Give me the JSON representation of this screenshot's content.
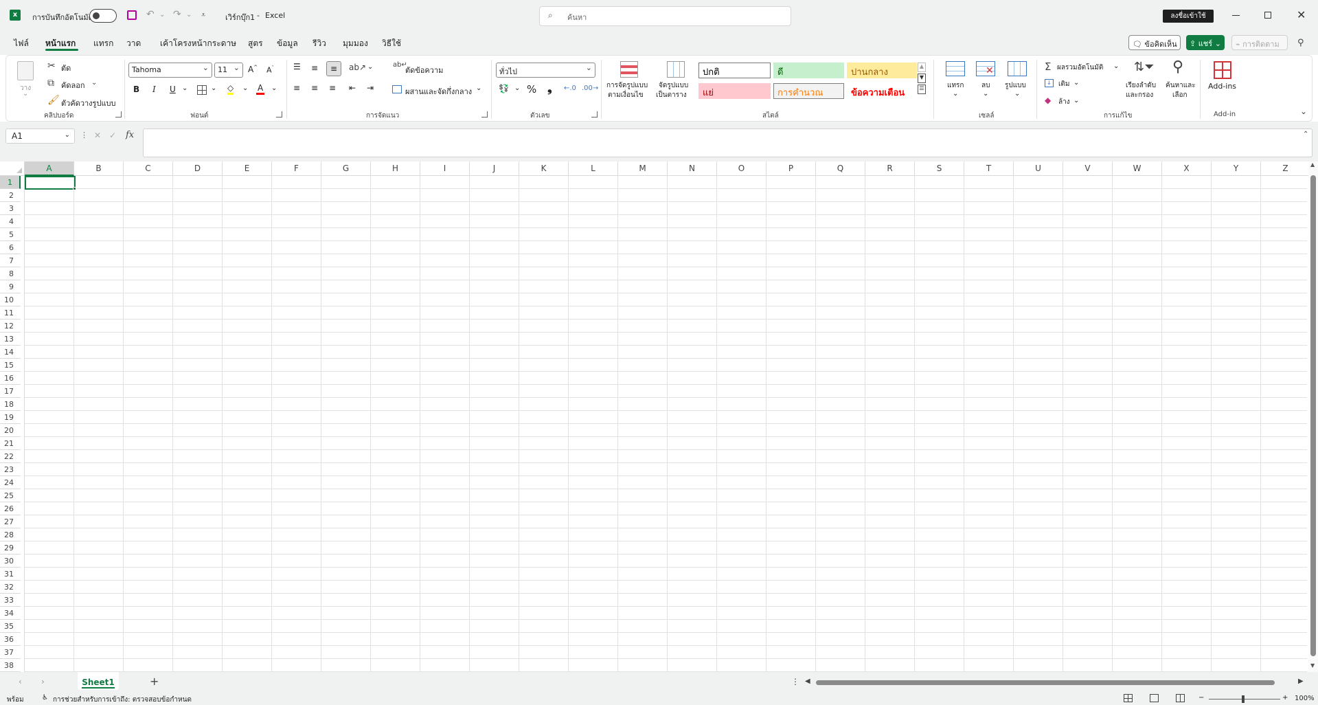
{
  "titlebar": {
    "autosave_label": "การบันทึกอัตโนมัติ",
    "doc_title": "เวิร์กบุ๊ก1",
    "app_separator": "-",
    "app_name": "Excel",
    "search_placeholder": "ค้นหา",
    "signin_label": "ลงชื่อเข้าใช้"
  },
  "menu": {
    "tabs": [
      "ไฟล์",
      "หน้าแรก",
      "แทรก",
      "วาด",
      "เค้าโครงหน้ากระดาษ",
      "สูตร",
      "ข้อมูล",
      "รีวิว",
      "มุมมอง",
      "วิธีใช้"
    ],
    "active_tab": "หน้าแรก",
    "comments_label": "ข้อคิดเห็น",
    "share_label": "แชร์",
    "catchup_label": "การติดตาม"
  },
  "ribbon": {
    "clipboard": {
      "paste_label": "วาง",
      "cut_label": "ตัด",
      "copy_label": "คัดลอก",
      "format_painter_label": "ตัวคัดวางรูปแบบ",
      "group_label": "คลิปบอร์ด"
    },
    "font": {
      "font_name": "Tahoma",
      "font_size": "11",
      "bold": "B",
      "italic": "I",
      "underline": "U",
      "font_color_glyph": "A",
      "group_label": "ฟอนต์"
    },
    "alignment": {
      "wrap_label": "ตัดข้อความ",
      "merge_label": "ผสานและจัดกึ่งกลาง",
      "group_label": "การจัดแนว"
    },
    "number": {
      "format_value": "ทั่วไป",
      "percent": "%",
      "comma": "❟",
      "group_label": "ตัวเลข"
    },
    "styles": {
      "conditional_label_1": "การจัดรูปแบบ",
      "conditional_label_2": "ตามเงื่อนไข",
      "format_table_label_1": "จัดรูปแบบ",
      "format_table_label_2": "เป็นตาราง",
      "cells": [
        {
          "label": "ปกติ",
          "bg": "#ffffff",
          "color": "#000000",
          "border": "#777777"
        },
        {
          "label": "ดี",
          "bg": "#c6efce",
          "color": "#006100",
          "border": "#c6efce"
        },
        {
          "label": "ปานกลาง",
          "bg": "#ffeb9c",
          "color": "#9c5700",
          "border": "#ffeb9c"
        },
        {
          "label": "แย่",
          "bg": "#ffc7ce",
          "color": "#9c0006",
          "border": "#ffc7ce"
        },
        {
          "label": "การคำนวณ",
          "bg": "#f2f2f2",
          "color": "#fa7d00",
          "border": "#7f7f7f"
        },
        {
          "label": "ข้อความเตือน",
          "bg": "#ffffff",
          "color": "#ff0000",
          "border": "#ffffff"
        }
      ],
      "group_label": "สไตล์"
    },
    "cells": {
      "insert_label": "แทรก",
      "delete_label": "ลบ",
      "format_label": "รูปแบบ",
      "group_label": "เซลล์"
    },
    "editing": {
      "autosum_label": "ผลรวมอัตโนมัติ",
      "fill_label": "เติม",
      "clear_label": "ล้าง",
      "sort_label_1": "เรียงลำดับ",
      "sort_label_2": "และกรอง",
      "find_label_1": "ค้นหาและ",
      "find_label_2": "เลือก",
      "group_label": "การแก้ไข"
    },
    "addin": {
      "addins_label": "Add-ins",
      "group_label": "Add-in"
    }
  },
  "formula": {
    "name_box": "A1",
    "fx": "fx",
    "content": ""
  },
  "grid": {
    "columns": [
      "A",
      "B",
      "C",
      "D",
      "E",
      "F",
      "G",
      "H",
      "I",
      "J",
      "K",
      "L",
      "M",
      "N",
      "O",
      "P",
      "Q",
      "R",
      "S",
      "T",
      "U",
      "V",
      "W",
      "X",
      "Y",
      "Z"
    ],
    "rows": [
      "1",
      "2",
      "3",
      "4",
      "5",
      "6",
      "7",
      "8",
      "9",
      "10",
      "11",
      "12",
      "13",
      "14",
      "15",
      "16",
      "17",
      "18",
      "19",
      "20",
      "21",
      "22",
      "23",
      "24",
      "25",
      "26",
      "27",
      "28",
      "29",
      "30",
      "31",
      "32",
      "33",
      "34",
      "35",
      "36",
      "37",
      "38"
    ],
    "selected_cell": "A1"
  },
  "sheets": {
    "tabs": [
      "Sheet1"
    ],
    "add_glyph": "+"
  },
  "status": {
    "ready": "พร้อม",
    "accessibility": "การช่วยสำหรับการเข้าถึง: ตรวจสอบข้อกำหนด",
    "zoom": "100%",
    "zoom_minus": "−",
    "zoom_plus": "+"
  }
}
